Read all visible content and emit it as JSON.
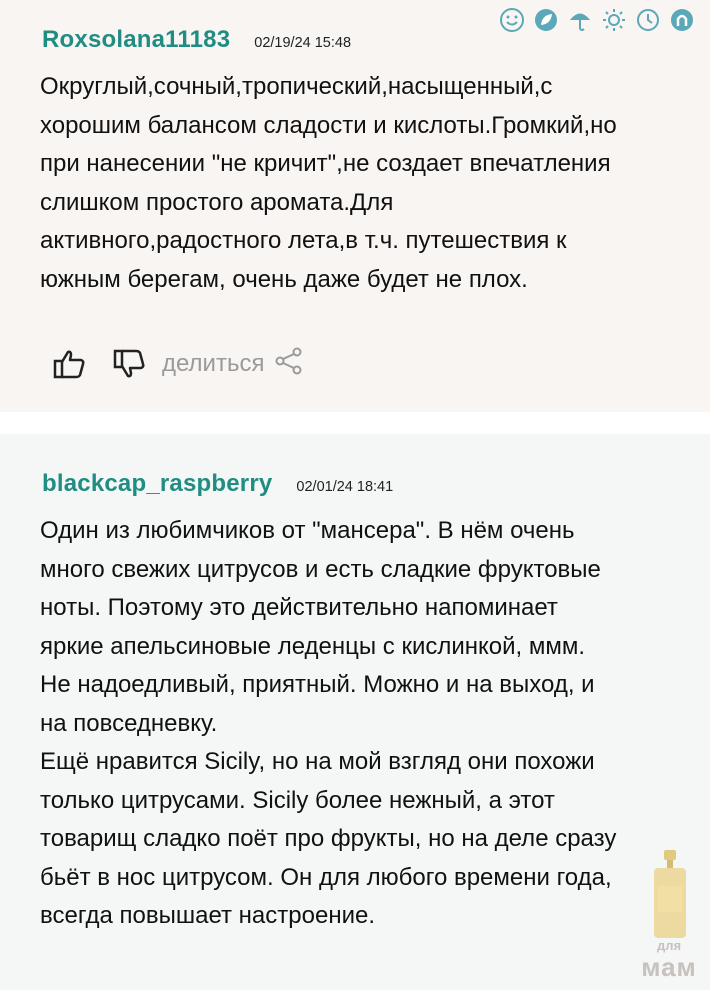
{
  "top_icons": [
    "smile-icon",
    "leaf-icon",
    "umbrella-icon",
    "sun-icon",
    "clock-icon",
    "horseshoe-icon"
  ],
  "reviews": [
    {
      "username": "Roxsolana11183",
      "date": "02/19/24 15:48",
      "lines": [
        "Округлый,сочный,тропический,насыщенный,с",
        "хорошим балансом сладости и кислоты.Громкий,но",
        "при нанесении \"не кричит\",не создает впечатления",
        "слишком простого аромата.Для",
        "активного,радостного лета,в т.ч. путешествия к",
        "южным берегам, очень даже будет не плох."
      ],
      "share_label": "делиться"
    },
    {
      "username": "blackcap_raspberry",
      "date": "02/01/24 18:41",
      "lines": [
        "Один из любимчиков от \"мансера\". В нём очень",
        "много свежих цитрусов и есть сладкие фруктовые",
        "ноты. Поэтому это действительно напоминает",
        "яркие апельсиновые леденцы с кислинкой, ммм.",
        "Не надоедливый, приятный. Можно и на выход, и",
        "на повседневку.",
        "Ещё нравится Sicily, но на мой взгляд они похожи",
        "только цитрусами. Sicily более нежный, а этот",
        "товарищ сладко поёт про фрукты, но на деле сразу",
        "бьёт в нос цитрусом. Он для любого времени года,",
        "всегда повышает настроение."
      ]
    }
  ],
  "promo": {
    "line1": "для",
    "line2": "мам"
  },
  "colors": {
    "username": "#1f8d82",
    "icon": "#5aa8b8",
    "bg_first": "#f8f5f3",
    "bg_second": "#f4f7f6"
  }
}
